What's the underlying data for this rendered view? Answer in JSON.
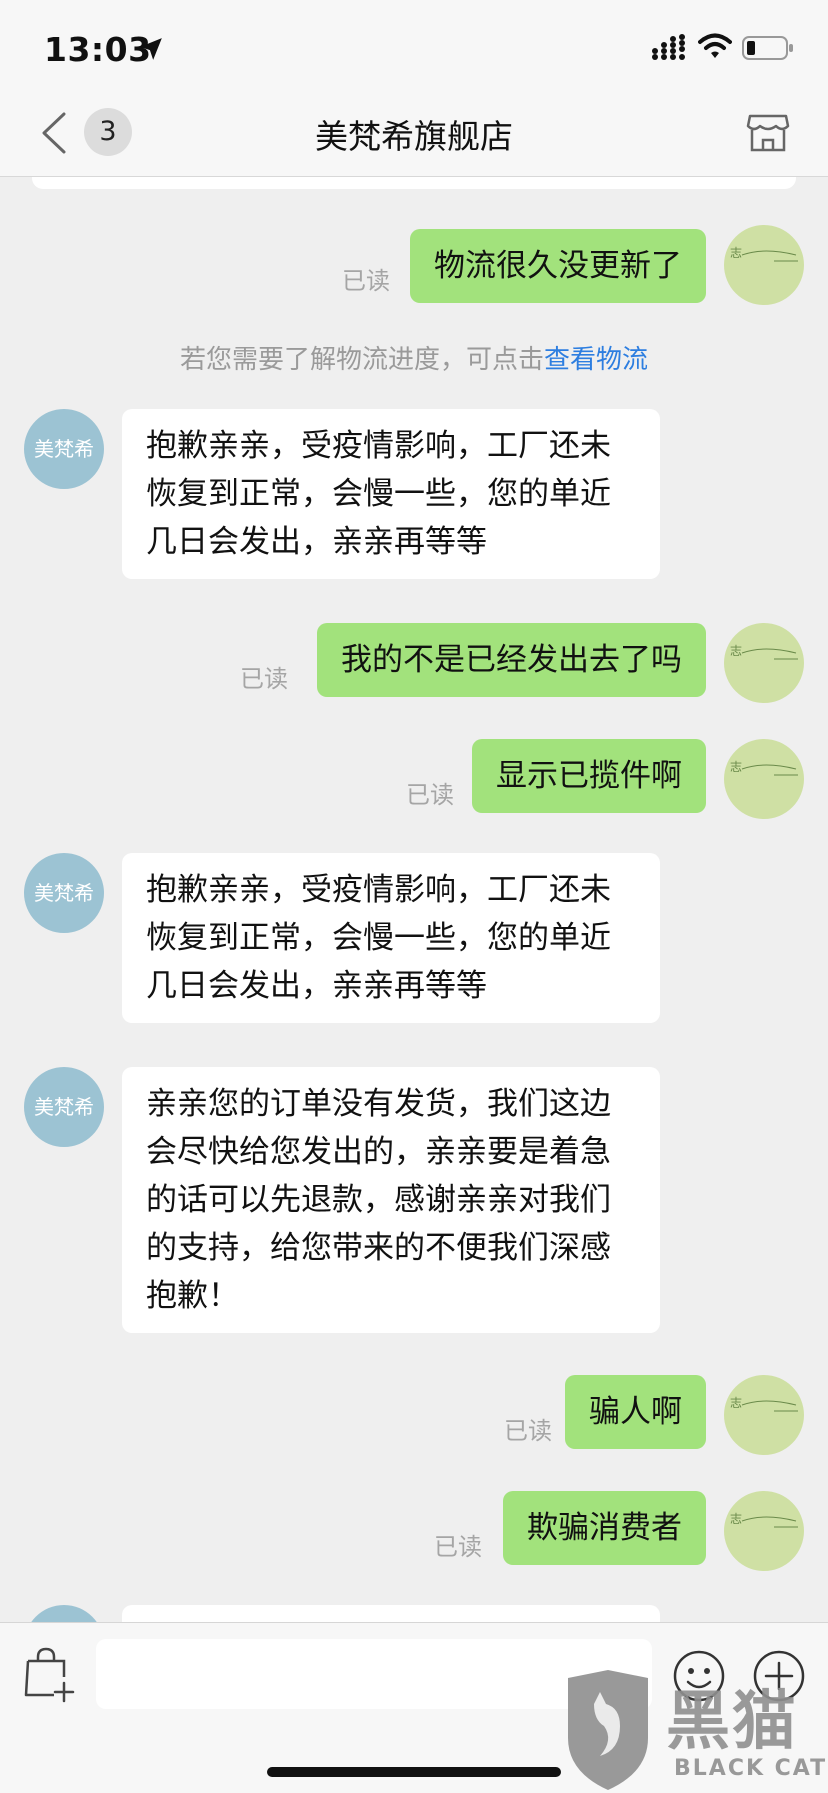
{
  "status_bar": {
    "time": "13:03"
  },
  "nav": {
    "badge_count": "3",
    "title": "美梵希旗舰店"
  },
  "messages": [
    {
      "type": "out",
      "text": "物流很久没更新了",
      "read": "已读"
    },
    {
      "type": "system",
      "text": "若您需要了解物流进度，可点击",
      "link": "查看物流"
    },
    {
      "type": "in",
      "avatar": "美梵希",
      "text": "抱歉亲亲，受疫情影响，工厂还未恢复到正常，会慢一些，您的单近几日会发出，亲亲再等等"
    },
    {
      "type": "out",
      "text": "我的不是已经发出去了吗",
      "read": "已读"
    },
    {
      "type": "out",
      "text": "显示已揽件啊",
      "read": "已读"
    },
    {
      "type": "in",
      "avatar": "美梵希",
      "text": "抱歉亲亲，受疫情影响，工厂还未恢复到正常，会慢一些，您的单近几日会发出，亲亲再等等"
    },
    {
      "type": "in",
      "avatar": "美梵希",
      "text": "亲亲您的订单没有发货，我们这边会尽快给您发出的，亲亲要是着急的话可以先退款，感谢亲亲对我们的支持，给您带来的不便我们深感抱歉！"
    },
    {
      "type": "out",
      "text": "骗人啊",
      "read": "已读"
    },
    {
      "type": "out",
      "text": "欺骗消费者",
      "read": "已读"
    }
  ],
  "input": {
    "value": ""
  },
  "watermark": {
    "cn": "黑猫",
    "en": "BLACK CAT"
  },
  "colors": {
    "outgoing_bubble": "#a2e27c",
    "incoming_bubble": "#ffffff",
    "link": "#2d7ee0",
    "shop_avatar": "#9cc3d3"
  }
}
